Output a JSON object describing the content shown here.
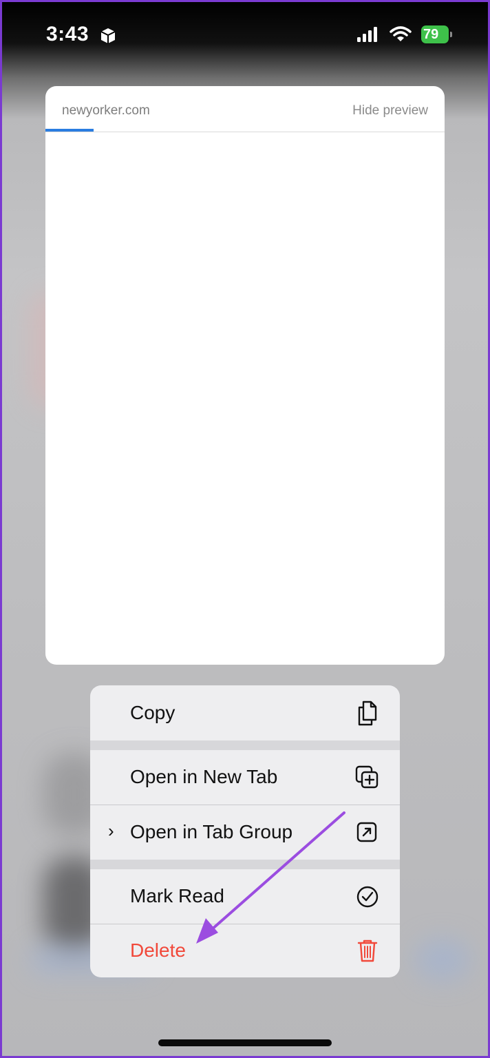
{
  "status_bar": {
    "time": "3:43",
    "battery_level": "79"
  },
  "preview": {
    "domain": "newyorker.com",
    "hide_label": "Hide preview",
    "load_progress": 0.12
  },
  "context_menu": {
    "items": [
      {
        "label": "Copy",
        "icon": "copy-icon"
      },
      {
        "label": "Open in New Tab",
        "icon": "new-tab-icon"
      },
      {
        "label": "Open in Tab Group",
        "icon": "arrow-up-right-square-icon",
        "has_submenu": true
      },
      {
        "label": "Mark Read",
        "icon": "checkmark-circle-icon"
      },
      {
        "label": "Delete",
        "icon": "trash-icon",
        "destructive": true
      }
    ]
  },
  "colors": {
    "accent": "#2a7de1",
    "destructive": "#f1483a",
    "battery": "#3ec14a",
    "annotation_arrow": "#9b4de0",
    "frame": "#7a3ad1"
  }
}
